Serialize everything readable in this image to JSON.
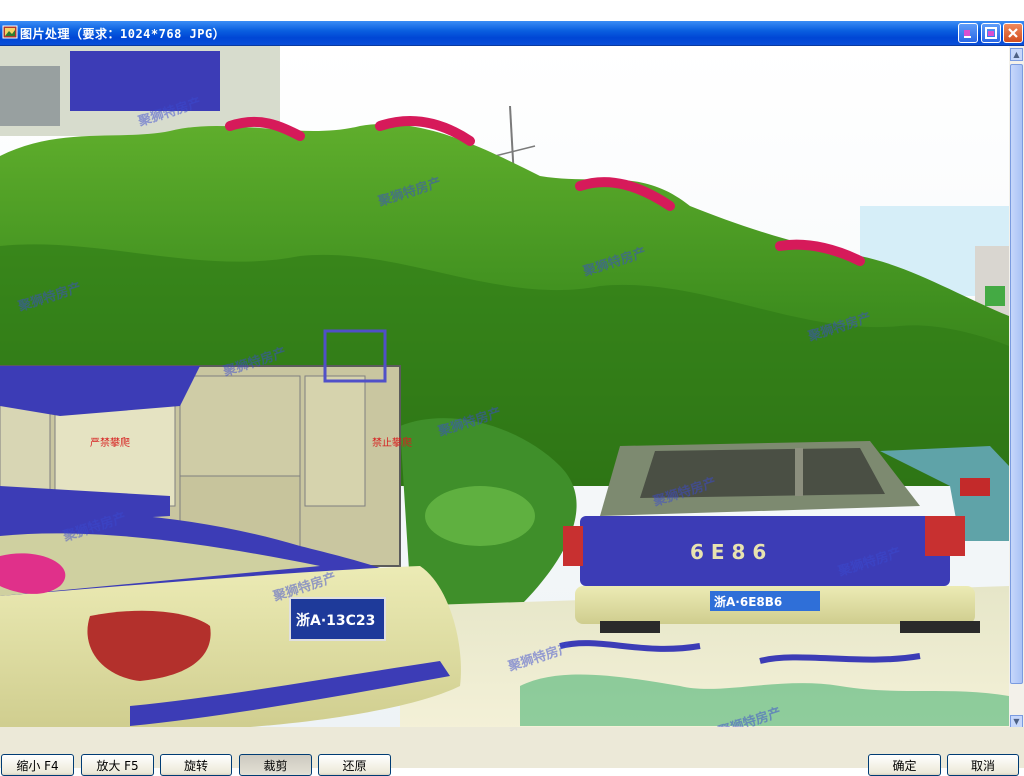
{
  "window": {
    "title": "图片处理（要求：1024*768 JPG）"
  },
  "icons": {
    "app": "photo-app-icon",
    "minimize": "minimize-icon",
    "maximize": "maximize-icon",
    "close": "close-icon"
  },
  "photo": {
    "plate_left": "浙A·13C23",
    "plate_right": "浙A·6E8B6",
    "tailgate_text": "6 E 8 6",
    "watermark": "聚狮特房产",
    "tank_text_1": "严禁攀爬",
    "tank_text_2": "禁止攀爬"
  },
  "toolbar": {
    "zoom_out": "缩小 F4",
    "zoom_in": "放大 F5",
    "rotate": "旋转",
    "crop": "裁剪",
    "restore": "还原",
    "confirm": "确定",
    "cancel": "取消"
  },
  "colors": {
    "title_bar": "#0a5fe0",
    "button_border": "#003c74",
    "toolbar_bg": "#ece9d8"
  }
}
